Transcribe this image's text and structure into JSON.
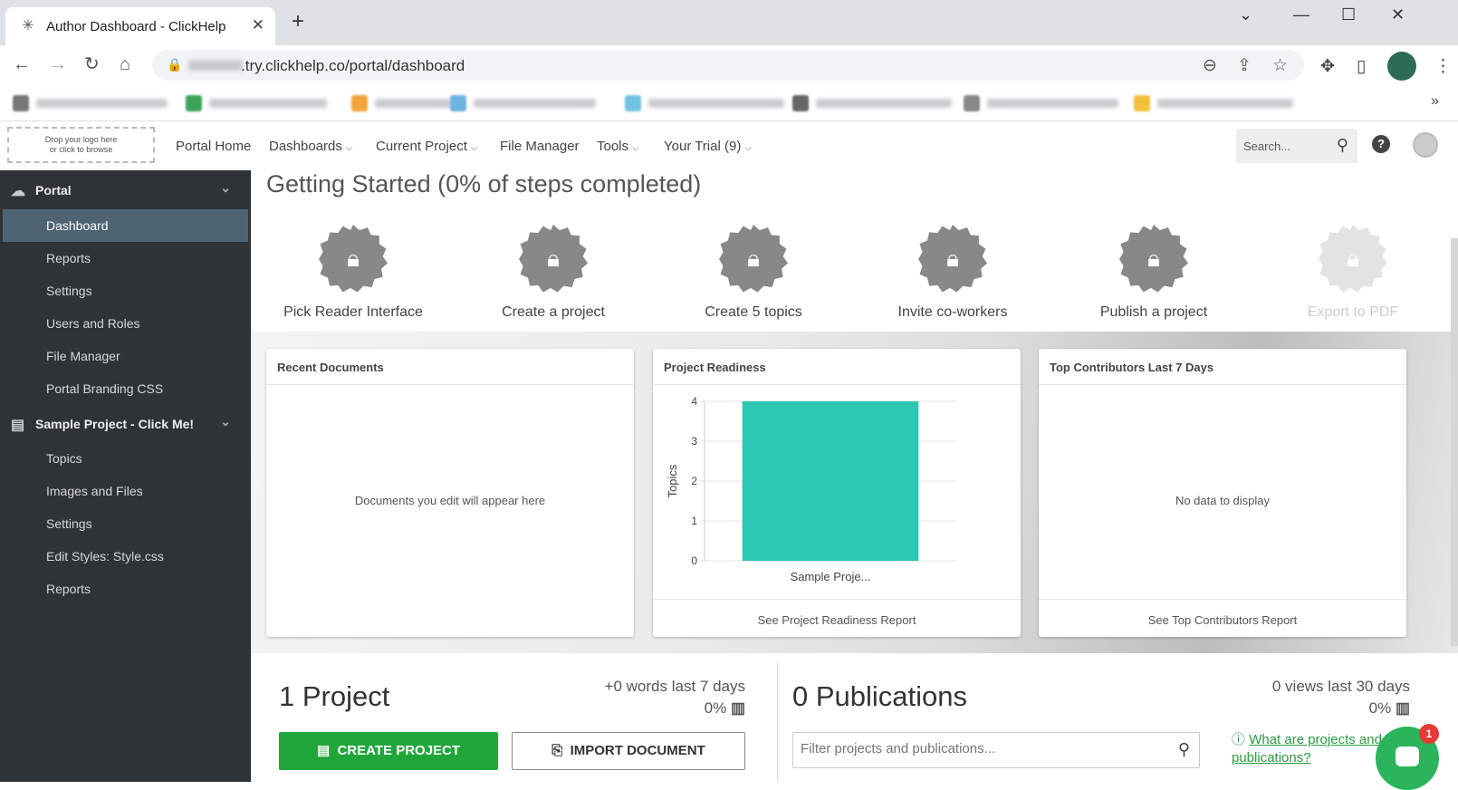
{
  "browser": {
    "tab_title": "Author Dashboard - ClickHelp",
    "url_visible": ".try.clickhelp.co/portal/dashboard",
    "window_controls": [
      "chevron-down-icon",
      "minimize-icon",
      "maximize-icon",
      "close-icon"
    ]
  },
  "header": {
    "logo_drop_line1": "Drop your logo here",
    "logo_drop_line2": "or click to browse",
    "nav": [
      {
        "label": "Portal Home",
        "has_dropdown": false
      },
      {
        "label": "Dashboards",
        "has_dropdown": true
      },
      {
        "label": "Current Project",
        "has_dropdown": true
      },
      {
        "label": "File Manager",
        "has_dropdown": false
      },
      {
        "label": "Tools",
        "has_dropdown": true
      },
      {
        "label": "Your Trial (9)",
        "has_dropdown": true
      }
    ],
    "search_placeholder": "Search..."
  },
  "sidebar": {
    "portal_section": "Portal",
    "portal_items": [
      "Dashboard",
      "Reports",
      "Settings",
      "Users and Roles",
      "File Manager",
      "Portal Branding CSS"
    ],
    "active_item": "Dashboard",
    "project_section": "Sample Project - Click Me!",
    "project_items": [
      "Topics",
      "Images and Files",
      "Settings",
      "Edit Styles: Style.css",
      "Reports"
    ]
  },
  "getting_started": {
    "title": "Getting Started (0% of steps completed)",
    "steps": [
      {
        "label": "Pick Reader Interface",
        "enabled": true
      },
      {
        "label": "Create a project",
        "enabled": true
      },
      {
        "label": "Create 5 topics",
        "enabled": true
      },
      {
        "label": "Invite co-workers",
        "enabled": true
      },
      {
        "label": "Publish a project",
        "enabled": true
      },
      {
        "label": "Export to PDF",
        "enabled": false
      }
    ]
  },
  "cards": {
    "recent": {
      "title": "Recent Documents",
      "empty": "Documents you edit will appear here"
    },
    "readiness": {
      "title": "Project Readiness",
      "footer": "See Project Readiness Report"
    },
    "contributors": {
      "title": "Top Contributors Last 7 Days",
      "empty": "No data to display",
      "footer": "See Top Contributors Report"
    }
  },
  "chart_data": {
    "type": "bar",
    "categories": [
      "Sample Proje..."
    ],
    "values": [
      4
    ],
    "ylabel": "Topics",
    "ylim": [
      0,
      4
    ],
    "yticks": [
      "4",
      "3",
      "2",
      "1",
      "0"
    ],
    "bar_color": "#2ec7b4"
  },
  "bottom": {
    "projects_title": "1 Project",
    "projects_stat": "+0 words last 7 days",
    "projects_pct": "0%",
    "create_label": "CREATE PROJECT",
    "import_label": "IMPORT DOCUMENT",
    "pubs_title": "0 Publications",
    "pubs_stat": "0 views last 30 days",
    "pubs_pct": "0%",
    "filter_placeholder": "Filter projects and publications...",
    "help_link": "What are projects and publications?",
    "chat_badge": "1"
  },
  "colors": {
    "sidebar_bg": "#2e3338",
    "sidebar_active": "#4f6473",
    "primary_button": "#20a53b",
    "link": "#2b9a3f"
  }
}
